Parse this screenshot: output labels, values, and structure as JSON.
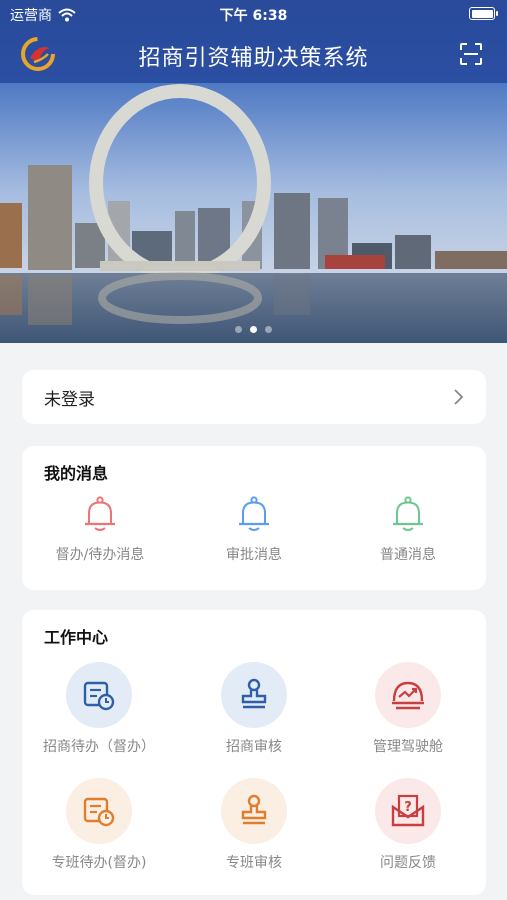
{
  "status": {
    "carrier": "运营商",
    "time": "下午 6:38"
  },
  "nav": {
    "title": "招商引资辅助决策系统"
  },
  "banner": {
    "dots": 3,
    "active_index": 1
  },
  "login": {
    "label": "未登录"
  },
  "messages": {
    "title": "我的消息",
    "items": [
      {
        "label": "督办/待办消息",
        "color": "#f07272"
      },
      {
        "label": "审批消息",
        "color": "#5b9ef0"
      },
      {
        "label": "普通消息",
        "color": "#6cc88e"
      }
    ]
  },
  "work": {
    "title": "工作中心",
    "items": [
      {
        "label": "招商待办（督办）",
        "icon": "calendar-clock-icon",
        "bg": "#e3ecf6",
        "fg": "#2f5fa8"
      },
      {
        "label": "招商审核",
        "icon": "stamp-icon",
        "bg": "#e3ecf6",
        "fg": "#2f5fa8"
      },
      {
        "label": "管理驾驶舱",
        "icon": "dashboard-trend-icon",
        "bg": "#fbe9ea",
        "fg": "#c83f3f"
      },
      {
        "label": "专班待办(督办)",
        "icon": "calendar-clock-icon",
        "bg": "#fbeee2",
        "fg": "#e07d2e"
      },
      {
        "label": "专班审核",
        "icon": "stamp-icon",
        "bg": "#fbeee2",
        "fg": "#e07d2e"
      },
      {
        "label": "问题反馈",
        "icon": "question-feedback-icon",
        "bg": "#fbe9ea",
        "fg": "#c83f3f"
      }
    ]
  }
}
